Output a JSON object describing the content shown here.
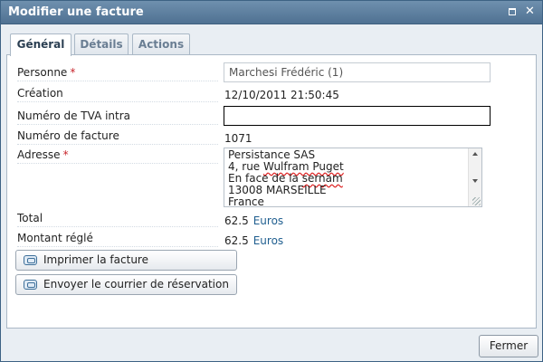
{
  "window": {
    "title": "Modifier une facture"
  },
  "tabs": [
    {
      "label": "Général",
      "active": true
    },
    {
      "label": "Détails",
      "active": false
    },
    {
      "label": "Actions",
      "active": false
    }
  ],
  "form": {
    "personne": {
      "label": "Personne",
      "required": "*",
      "value": "Marchesi Frédéric (1)"
    },
    "creation": {
      "label": "Création",
      "value": "12/10/2011 21:50:45"
    },
    "tva": {
      "label": "Numéro de TVA intra",
      "value": ""
    },
    "facture": {
      "label": "Numéro de facture",
      "value": "1071"
    },
    "adresse": {
      "label": "Adresse",
      "required": "*",
      "lines": [
        "Persistance SAS",
        "4, rue Wulfram Puget",
        "En face de la sernam",
        "13008 MARSEILLE",
        "France"
      ],
      "line2_prefix": "4, rue ",
      "line2_misspelled": "Wulfram Puget",
      "line3_prefix": "En face de la ",
      "line3_misspelled": "sernam"
    },
    "total": {
      "label": "Total",
      "value": "62.5",
      "unit": "Euros"
    },
    "regle": {
      "label": "Montant réglé",
      "value": "62.5",
      "unit": "Euros"
    }
  },
  "buttons": {
    "imprimer": "Imprimer la facture",
    "envoyer": "Envoyer le courrier de réservation",
    "fermer": "Fermer"
  },
  "icons": {
    "maximize": "maximize-icon",
    "close": "close-icon",
    "print": "print-icon",
    "send": "send-icon"
  },
  "colors": {
    "titlebar": "#5a7b9c",
    "required": "#c8252c",
    "unit_link": "#1f5e8f"
  }
}
